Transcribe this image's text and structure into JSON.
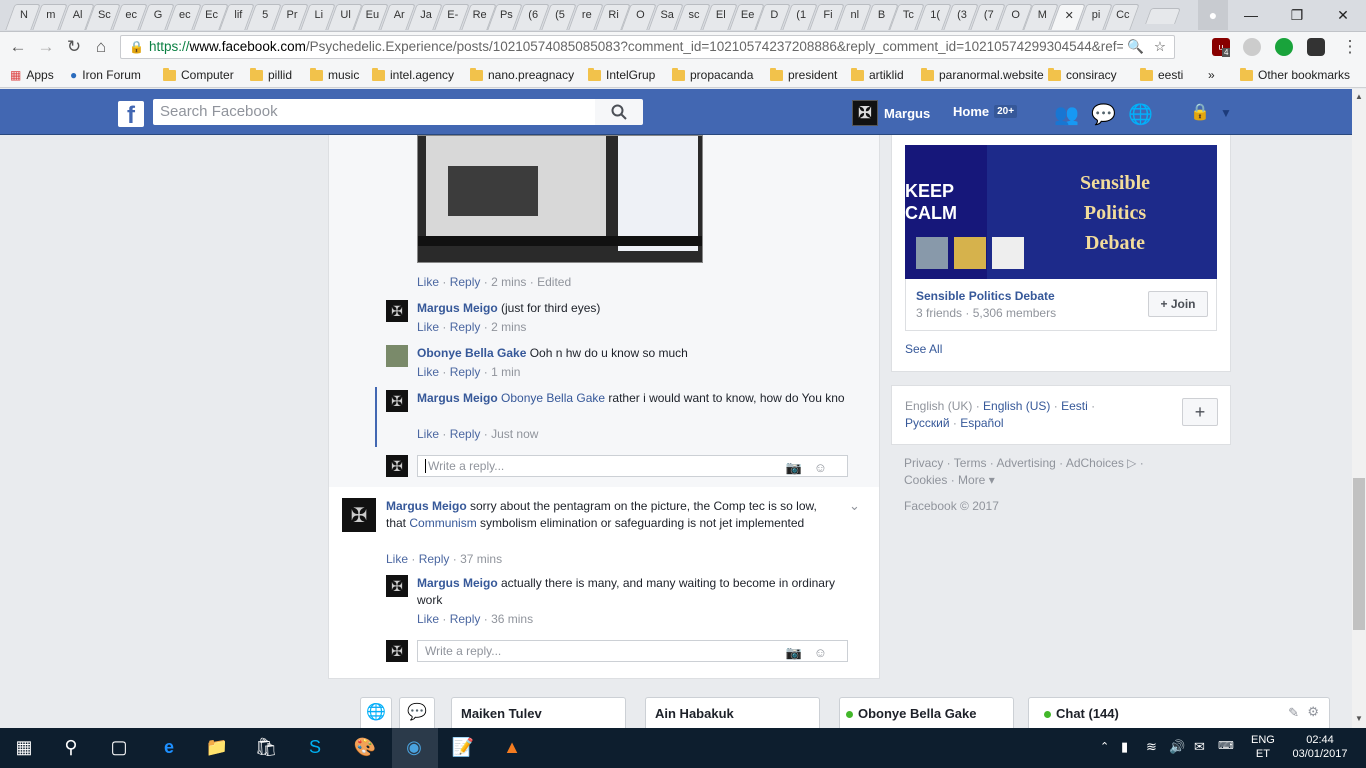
{
  "browser": {
    "tabs": [
      "N",
      "m",
      "Al",
      "Sc",
      "ec",
      "G",
      "ec",
      "Ec",
      "lif",
      "5",
      "Pr",
      "Li",
      "Ul",
      "Eu",
      "Ar",
      "Ja",
      "E-",
      "Re",
      "Ps",
      "(6",
      "(5",
      "re",
      "Ri",
      "O",
      "Sa",
      "sc",
      "El",
      "Ee",
      "D",
      "(1",
      "Fi",
      "nl",
      "B",
      "Tc",
      "1(",
      "(3",
      "(7",
      "O",
      "M",
      "",
      "pi",
      "Cc"
    ],
    "url_prefix": "https://",
    "url_host": "www.facebook.com",
    "url_rest": "/Psychedelic.Experience/posts/10210574085085083?comment_id=10210574237208886&reply_comment_id=10210574299304544&ref=",
    "ublock_count": "4",
    "bookmarks": [
      {
        "label": "Apps",
        "kind": "apps"
      },
      {
        "label": "Iron Forum",
        "kind": "globe"
      },
      {
        "label": "Computer",
        "kind": "folder"
      },
      {
        "label": "pillid",
        "kind": "folder"
      },
      {
        "label": "music",
        "kind": "folder"
      },
      {
        "label": "intel.agency",
        "kind": "folder"
      },
      {
        "label": "nano.preagnacy",
        "kind": "folder"
      },
      {
        "label": "IntelGrup",
        "kind": "folder"
      },
      {
        "label": "propacanda",
        "kind": "folder"
      },
      {
        "label": "president",
        "kind": "folder"
      },
      {
        "label": "artiklid",
        "kind": "folder"
      },
      {
        "label": "paranormal.website",
        "kind": "folder"
      },
      {
        "label": "consiracy",
        "kind": "folder"
      },
      {
        "label": "eesti",
        "kind": "folder"
      }
    ],
    "bookmarks_more": "»",
    "other_bookmarks": "Other bookmarks"
  },
  "fb": {
    "search_placeholder": "Search Facebook",
    "user_name": "Margus",
    "home_label": "Home",
    "home_badge": "20+"
  },
  "comments": {
    "c0_meta": {
      "like": "Like",
      "reply": "Reply",
      "time": "2 mins",
      "edited": "Edited"
    },
    "replies": [
      {
        "name": "Margus Meigo",
        "text": " (just for third eyes)",
        "time": "2 mins"
      },
      {
        "name": "Obonye Bella Gake",
        "text": " Ooh n hw do u know so much",
        "time": "1 min"
      },
      {
        "name": "Margus Meigo",
        "mention": "Obonye Bella Gake",
        "text": " rather i would want to know, how do You kno",
        "time": "Just now"
      }
    ],
    "reply_placeholder_1": "Write a reply...",
    "top_comment": {
      "name": "Margus Meigo",
      "text_a": " sorry about the pentagram on the picture, the Comp tec is so low, that ",
      "link": "Communism",
      "text_b": " symbolism elimination or safeguarding is not jet implemented",
      "time": "37 mins"
    },
    "sub_reply": {
      "name": "Margus Meigo",
      "text": " actually there is many, and many waiting to become in ordinary work",
      "time": "36 mins"
    },
    "reply_placeholder_2": "Write a reply...",
    "like": "Like",
    "reply": "Reply",
    "dot": "·"
  },
  "sidebar": {
    "group_image_text": "Sensible Politics Debate",
    "keep_calm": "KEEP CALM",
    "group_name": "Sensible Politics Debate",
    "group_meta": "3 friends · 5,306 members",
    "join_label": "+ Join",
    "see_all": "See All",
    "languages_line1": [
      "English (UK)",
      "English (US)",
      "Eesti"
    ],
    "languages_line2": [
      "Русский",
      "Español"
    ],
    "footer_line1": "Privacy · Terms · Advertising · AdChoices ▷ ·",
    "footer_line2": "Cookies · More ▾",
    "copyright": "Facebook © 2017"
  },
  "chat": {
    "tabs": [
      "Maiken Tulev",
      "Ain Habakuk",
      "Obonye Bella Gake",
      "Chat (144)"
    ]
  },
  "taskbar": {
    "lang": "ENG",
    "lang_sub": "ET",
    "time": "02:44",
    "date": "03/01/2017"
  },
  "colors": {
    "fb_blue": "#4267b2",
    "link": "#365899",
    "online": "#42b72a"
  }
}
